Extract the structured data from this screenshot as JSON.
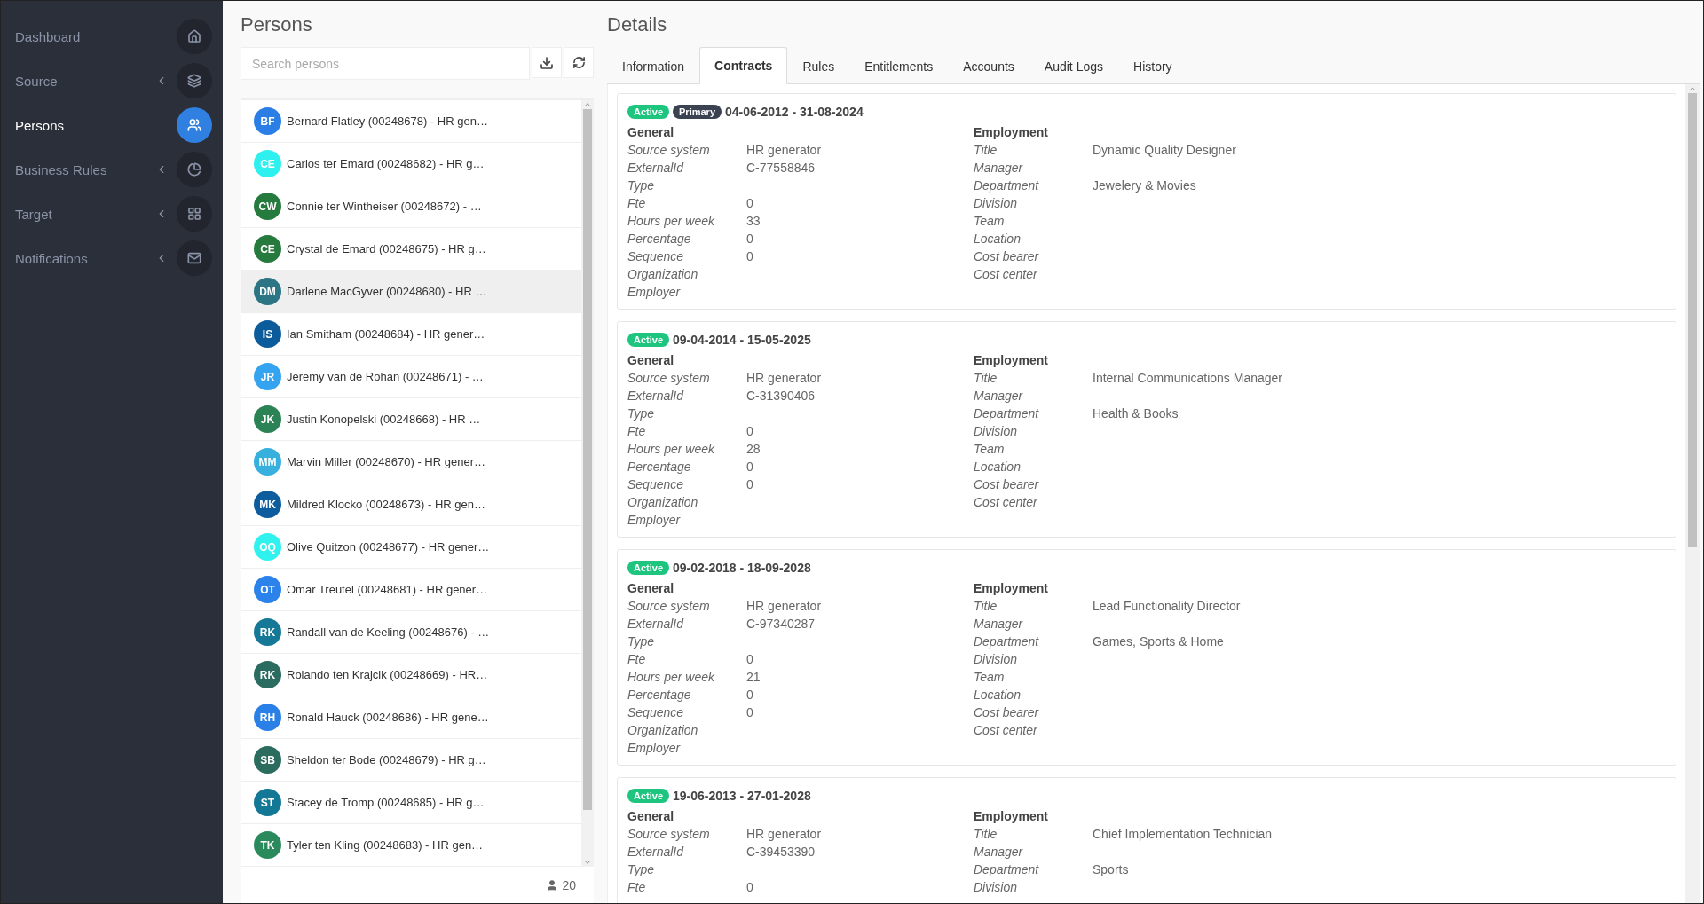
{
  "sidebar": {
    "items": [
      {
        "label": "Dashboard",
        "expandable": false,
        "selected": false
      },
      {
        "label": "Source",
        "expandable": true,
        "selected": false
      },
      {
        "label": "Persons",
        "expandable": false,
        "selected": true
      },
      {
        "label": "Business Rules",
        "expandable": true,
        "selected": false
      },
      {
        "label": "Target",
        "expandable": true,
        "selected": false
      },
      {
        "label": "Notifications",
        "expandable": true,
        "selected": false
      }
    ]
  },
  "persons": {
    "title": "Persons",
    "search": {
      "placeholder": "Search persons"
    },
    "items": [
      {
        "initials": "BF",
        "name": "Bernard Flatley (00248678) - HR gen…",
        "color": "#2b7ee6",
        "selected": false
      },
      {
        "initials": "CE",
        "name": "Carlos ter Emard (00248682) - HR g…",
        "color": "#2ef0ef",
        "selected": false
      },
      {
        "initials": "CW",
        "name": "Connie ter Wintheiser (00248672) - …",
        "color": "#257a3e",
        "selected": false
      },
      {
        "initials": "CE",
        "name": "Crystal de Emard (00248675) - HR g…",
        "color": "#267a3e",
        "selected": false
      },
      {
        "initials": "DM",
        "name": "Darlene MacGyver (00248680) - HR …",
        "color": "#2b7584",
        "selected": true
      },
      {
        "initials": "IS",
        "name": "Ian Smitham (00248684) - HR gener…",
        "color": "#0c5c9c",
        "selected": false
      },
      {
        "initials": "JR",
        "name": "Jeremy van de Rohan (00248671) - …",
        "color": "#35a4f0",
        "selected": false
      },
      {
        "initials": "JK",
        "name": "Justin Konopelski (00248668) - HR …",
        "color": "#2b8254",
        "selected": false
      },
      {
        "initials": "MM",
        "name": "Marvin Miller (00248670) - HR gener…",
        "color": "#38b0de",
        "selected": false
      },
      {
        "initials": "MK",
        "name": "Mildred Klocko (00248673) - HR gen…",
        "color": "#0d5c9d",
        "selected": false
      },
      {
        "initials": "OQ",
        "name": "Olive Quitzon (00248677) - HR gener…",
        "color": "#2ff2ee",
        "selected": false
      },
      {
        "initials": "OT",
        "name": "Omar Treutel (00248681) - HR gener…",
        "color": "#2a82ea",
        "selected": false
      },
      {
        "initials": "RK",
        "name": "Randall van de Keeling (00248676) - …",
        "color": "#147896",
        "selected": false
      },
      {
        "initials": "RK",
        "name": "Rolando ten Krajcik (00248669) - HR…",
        "color": "#2a6c60",
        "selected": false
      },
      {
        "initials": "RH",
        "name": "Ronald Hauck (00248686) - HR gene…",
        "color": "#2b80e8",
        "selected": false
      },
      {
        "initials": "SB",
        "name": "Sheldon ter Bode (00248679) - HR g…",
        "color": "#2b6c5f",
        "selected": false
      },
      {
        "initials": "ST",
        "name": "Stacey de Tromp (00248685) - HR g…",
        "color": "#137896",
        "selected": false
      },
      {
        "initials": "TK",
        "name": "Tyler ten Kling (00248683) - HR gen…",
        "color": "#2b8a5c",
        "selected": false
      }
    ],
    "count": "20"
  },
  "details": {
    "title": "Details",
    "tabs": [
      {
        "label": "Information",
        "selected": false
      },
      {
        "label": "Contracts",
        "selected": true
      },
      {
        "label": "Rules",
        "selected": false
      },
      {
        "label": "Entitlements",
        "selected": false
      },
      {
        "label": "Accounts",
        "selected": false
      },
      {
        "label": "Audit Logs",
        "selected": false
      },
      {
        "label": "History",
        "selected": false
      }
    ],
    "contracts": [
      {
        "badges": [
          {
            "label": "Active",
            "kind": "active"
          },
          {
            "label": "Primary",
            "kind": "primary"
          }
        ],
        "period": "04-06-2012 - 31-08-2024",
        "general_title": "General",
        "employment_title": "Employment",
        "general": [
          {
            "label": "Source system",
            "value": "HR generator"
          },
          {
            "label": "ExternalId",
            "value": "C-77558846"
          },
          {
            "label": "Type"
          },
          {
            "label": "Fte",
            "value": "0"
          },
          {
            "label": "Hours per week",
            "value": "33"
          },
          {
            "label": "Percentage",
            "value": "0"
          },
          {
            "label": "Sequence",
            "value": "0"
          },
          {
            "label": "Organization"
          },
          {
            "label": "Employer"
          }
        ],
        "employment": [
          {
            "label": "Title",
            "value": "Dynamic Quality Designer"
          },
          {
            "label": "Manager"
          },
          {
            "label": "Department",
            "value": "Jewelery & Movies"
          },
          {
            "label": "Division"
          },
          {
            "label": "Team"
          },
          {
            "label": "Location"
          },
          {
            "label": "Cost bearer"
          },
          {
            "label": "Cost center"
          }
        ]
      },
      {
        "badges": [
          {
            "label": "Active",
            "kind": "active"
          }
        ],
        "period": "09-04-2014 - 15-05-2025",
        "general_title": "General",
        "employment_title": "Employment",
        "general": [
          {
            "label": "Source system",
            "value": "HR generator"
          },
          {
            "label": "ExternalId",
            "value": "C-31390406"
          },
          {
            "label": "Type"
          },
          {
            "label": "Fte",
            "value": "0"
          },
          {
            "label": "Hours per week",
            "value": "28"
          },
          {
            "label": "Percentage",
            "value": "0"
          },
          {
            "label": "Sequence",
            "value": "0"
          },
          {
            "label": "Organization"
          },
          {
            "label": "Employer"
          }
        ],
        "employment": [
          {
            "label": "Title",
            "value": "Internal Communications Manager"
          },
          {
            "label": "Manager"
          },
          {
            "label": "Department",
            "value": "Health & Books"
          },
          {
            "label": "Division"
          },
          {
            "label": "Team"
          },
          {
            "label": "Location"
          },
          {
            "label": "Cost bearer"
          },
          {
            "label": "Cost center"
          }
        ]
      },
      {
        "badges": [
          {
            "label": "Active",
            "kind": "active"
          }
        ],
        "period": "09-02-2018 - 18-09-2028",
        "general_title": "General",
        "employment_title": "Employment",
        "general": [
          {
            "label": "Source system",
            "value": "HR generator"
          },
          {
            "label": "ExternalId",
            "value": "C-97340287"
          },
          {
            "label": "Type"
          },
          {
            "label": "Fte",
            "value": "0"
          },
          {
            "label": "Hours per week",
            "value": "21"
          },
          {
            "label": "Percentage",
            "value": "0"
          },
          {
            "label": "Sequence",
            "value": "0"
          },
          {
            "label": "Organization"
          },
          {
            "label": "Employer"
          }
        ],
        "employment": [
          {
            "label": "Title",
            "value": "Lead Functionality Director"
          },
          {
            "label": "Manager"
          },
          {
            "label": "Department",
            "value": "Games, Sports & Home"
          },
          {
            "label": "Division"
          },
          {
            "label": "Team"
          },
          {
            "label": "Location"
          },
          {
            "label": "Cost bearer"
          },
          {
            "label": "Cost center"
          }
        ]
      },
      {
        "badges": [
          {
            "label": "Active",
            "kind": "active"
          }
        ],
        "period": "19-06-2013 - 27-01-2028",
        "general_title": "General",
        "employment_title": "Employment",
        "general": [
          {
            "label": "Source system",
            "value": "HR generator"
          },
          {
            "label": "ExternalId",
            "value": "C-39453390"
          },
          {
            "label": "Type"
          },
          {
            "label": "Fte",
            "value": "0"
          }
        ],
        "employment": [
          {
            "label": "Title",
            "value": "Chief Implementation Technician"
          },
          {
            "label": "Manager"
          },
          {
            "label": "Department",
            "value": "Sports"
          },
          {
            "label": "Division"
          }
        ]
      }
    ]
  }
}
